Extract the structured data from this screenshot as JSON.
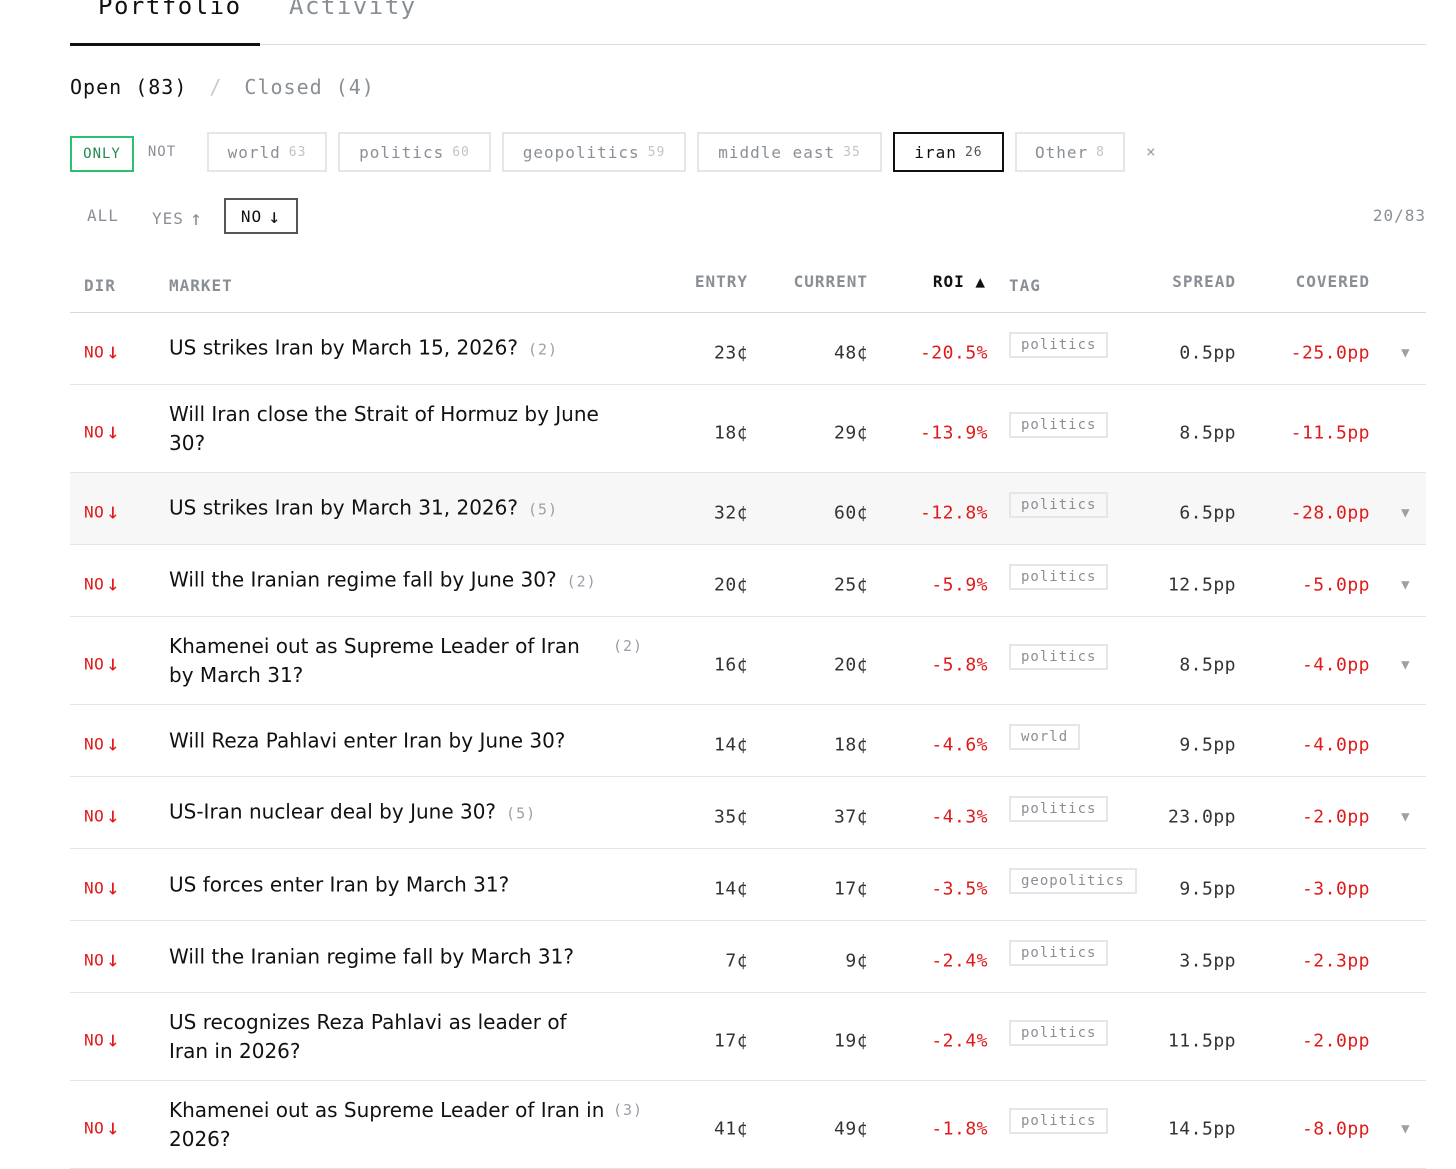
{
  "tabs": [
    {
      "label": "Portfolio",
      "active": true
    },
    {
      "label": "Activity",
      "active": false
    }
  ],
  "status": {
    "open": "Open (83)",
    "separator": "/",
    "closed": "Closed (4)"
  },
  "filter_mode": {
    "only": "ONLY",
    "not": "NOT"
  },
  "tags": [
    {
      "label": "world",
      "count": "63",
      "active": false
    },
    {
      "label": "politics",
      "count": "60",
      "active": false
    },
    {
      "label": "geopolitics",
      "count": "59",
      "active": false
    },
    {
      "label": "middle east",
      "count": "35",
      "active": false
    },
    {
      "label": "iran",
      "count": "26",
      "active": true
    },
    {
      "label": "Other",
      "count": "8",
      "active": false
    }
  ],
  "clear_icon": "×",
  "direction_filter": {
    "all": "ALL",
    "yes": "YES",
    "yes_arrow": "↑",
    "no": "NO",
    "no_arrow": "↓",
    "selected": "NO"
  },
  "result_count": "20/83",
  "columns": {
    "dir": "DIR",
    "market": "MARKET",
    "entry": "ENTRY",
    "current": "CURRENT",
    "roi": "ROI ▲",
    "tag": "TAG",
    "spread": "SPREAD",
    "covered": "COVERED"
  },
  "colors": {
    "negative": "#e01a1a",
    "only_border": "#2fbf71",
    "muted": "#8a8f96"
  },
  "rows": [
    {
      "dir": "NO",
      "dir_arrow": "↓",
      "market": "US strikes Iran by March 15, 2026?",
      "sub": "(2)",
      "entry": "23¢",
      "current": "48¢",
      "roi": "-20.5%",
      "tag": "politics",
      "spread": "0.5pp",
      "covered": "-25.0pp",
      "expandable": true,
      "expand_icon": "▼"
    },
    {
      "dir": "NO",
      "dir_arrow": "↓",
      "market": "Will Iran close the Strait of Hormuz by June 30?",
      "sub": "",
      "entry": "18¢",
      "current": "29¢",
      "roi": "-13.9%",
      "tag": "politics",
      "spread": "8.5pp",
      "covered": "-11.5pp",
      "expandable": false,
      "expand_icon": ""
    },
    {
      "dir": "NO",
      "dir_arrow": "↓",
      "market": "US strikes Iran by March 31, 2026?",
      "sub": "(5)",
      "entry": "32¢",
      "current": "60¢",
      "roi": "-12.8%",
      "tag": "politics",
      "spread": "6.5pp",
      "covered": "-28.0pp",
      "expandable": true,
      "expand_icon": "▼"
    },
    {
      "dir": "NO",
      "dir_arrow": "↓",
      "market": "Will the Iranian regime fall by June 30?",
      "sub": "(2)",
      "entry": "20¢",
      "current": "25¢",
      "roi": "-5.9%",
      "tag": "politics",
      "spread": "12.5pp",
      "covered": "-5.0pp",
      "expandable": true,
      "expand_icon": "▼"
    },
    {
      "dir": "NO",
      "dir_arrow": "↓",
      "market": "Khamenei out as Supreme Leader of Iran by March 31?",
      "sub": "(2)",
      "entry": "16¢",
      "current": "20¢",
      "roi": "-5.8%",
      "tag": "politics",
      "spread": "8.5pp",
      "covered": "-4.0pp",
      "expandable": true,
      "expand_icon": "▼"
    },
    {
      "dir": "NO",
      "dir_arrow": "↓",
      "market": "Will Reza Pahlavi enter Iran by June 30?",
      "sub": "",
      "entry": "14¢",
      "current": "18¢",
      "roi": "-4.6%",
      "tag": "world",
      "spread": "9.5pp",
      "covered": "-4.0pp",
      "expandable": false,
      "expand_icon": ""
    },
    {
      "dir": "NO",
      "dir_arrow": "↓",
      "market": "US-Iran nuclear deal by June 30?",
      "sub": "(5)",
      "entry": "35¢",
      "current": "37¢",
      "roi": "-4.3%",
      "tag": "politics",
      "spread": "23.0pp",
      "covered": "-2.0pp",
      "expandable": true,
      "expand_icon": "▼"
    },
    {
      "dir": "NO",
      "dir_arrow": "↓",
      "market": "US forces enter Iran by March 31?",
      "sub": "",
      "entry": "14¢",
      "current": "17¢",
      "roi": "-3.5%",
      "tag": "geopolitics",
      "spread": "9.5pp",
      "covered": "-3.0pp",
      "expandable": false,
      "expand_icon": ""
    },
    {
      "dir": "NO",
      "dir_arrow": "↓",
      "market": "Will the Iranian regime fall by March 31?",
      "sub": "",
      "entry": "7¢",
      "current": "9¢",
      "roi": "-2.4%",
      "tag": "politics",
      "spread": "3.5pp",
      "covered": "-2.3pp",
      "expandable": false,
      "expand_icon": ""
    },
    {
      "dir": "NO",
      "dir_arrow": "↓",
      "market": "US recognizes Reza Pahlavi as leader of Iran in 2026?",
      "sub": "",
      "entry": "17¢",
      "current": "19¢",
      "roi": "-2.4%",
      "tag": "politics",
      "spread": "11.5pp",
      "covered": "-2.0pp",
      "expandable": false,
      "expand_icon": ""
    },
    {
      "dir": "NO",
      "dir_arrow": "↓",
      "market": "Khamenei out as Supreme Leader of Iran in 2026?",
      "sub": "(3)",
      "entry": "41¢",
      "current": "49¢",
      "roi": "-1.8%",
      "tag": "politics",
      "spread": "14.5pp",
      "covered": "-8.0pp",
      "expandable": true,
      "expand_icon": "▼"
    }
  ]
}
